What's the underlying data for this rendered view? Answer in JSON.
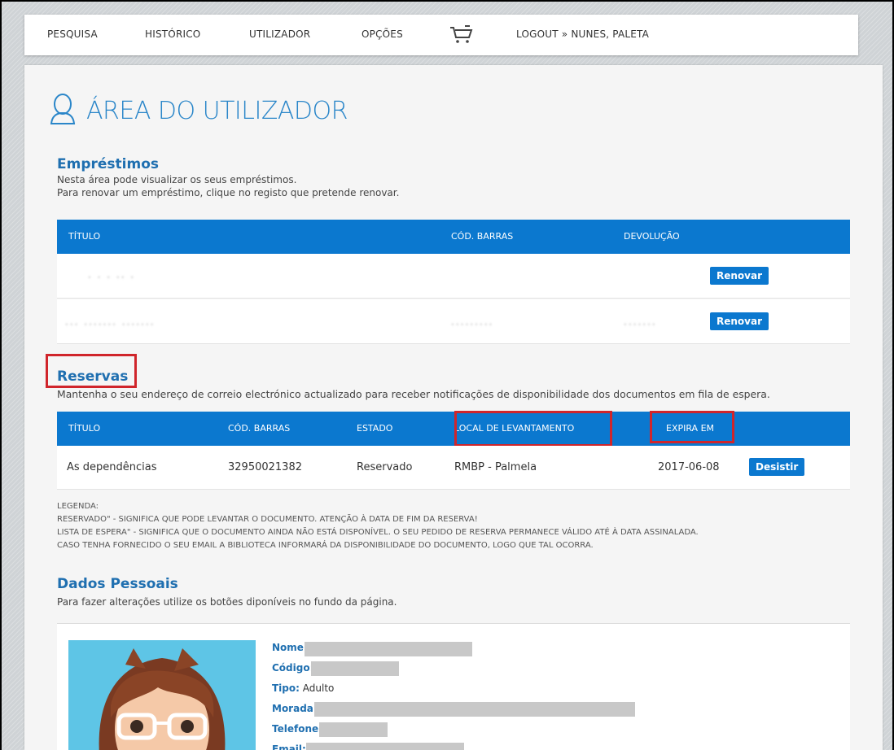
{
  "nav": {
    "items": [
      "PESQUISA",
      "HISTÓRICO",
      "UTILIZADOR",
      "OPÇÕES"
    ],
    "cart_icon": "shopping-cart-icon",
    "logout": "LOGOUT » NUNES, PALETA"
  },
  "page": {
    "title": "ÁREA DO UTILIZADOR",
    "title_icon": "user-icon"
  },
  "emprestimos": {
    "title": "Empréstimos",
    "desc1": "Nesta área pode visualizar os seus empréstimos.",
    "desc2": "Para renovar um empréstimo, clique no registo que pretende renovar.",
    "headers": [
      "TÍTULO",
      "CÓD. BARRAS",
      "DEVOLUÇÃO"
    ],
    "rows": [
      {
        "title": "· · ·  ·· ·",
        "barcode": "",
        "due": "",
        "button": "Renovar"
      },
      {
        "title": "··· ······· ·······",
        "barcode": "·········",
        "due": "·······",
        "button": "Renovar"
      }
    ]
  },
  "reservas": {
    "title": "Reservas",
    "desc": "Mantenha o seu endereço de correio electrónico actualizado para receber notificações de disponibilidade dos documentos em fila de espera.",
    "headers": [
      "TÍTULO",
      "CÓD. BARRAS",
      "ESTADO",
      "LOCAL DE LEVANTAMENTO",
      "EXPIRA EM"
    ],
    "rows": [
      {
        "title": "As dependências",
        "barcode": "32950021382",
        "status": "Reservado",
        "location": "RMBP - Palmela",
        "expires": "2017-06-08",
        "button": "Desistir"
      }
    ]
  },
  "legend": {
    "label": "LEGENDA:",
    "line1": "RESERVADO\" - SIGNIFICA QUE PODE LEVANTAR O DOCUMENTO. ATENÇÃO À DATA DE FIM DA RESERVA!",
    "line2": "LISTA DE ESPERA\" - SIGNIFICA QUE O DOCUMENTO AINDA NÃO ESTÁ DISPONÍVEL. O SEU PEDIDO DE RESERVA PERMANECE VÁLIDO ATÉ À DATA ASSINALADA.",
    "line3": "CASO TENHA FORNECIDO O SEU EMAIL A BIBLIOTECA INFORMARÁ DA DISPONIBILIDADE DO DOCUMENTO, LOGO QUE TAL OCORRA."
  },
  "dados": {
    "title": "Dados Pessoais",
    "desc": "Para fazer alterações utilize os botões diponíveis no fundo da página.",
    "fields": [
      {
        "label": "Nome:",
        "value": ""
      },
      {
        "label": "Código:",
        "value": ""
      },
      {
        "label": "Tipo:",
        "value": "Adulto"
      },
      {
        "label": "Morada:",
        "value": ""
      },
      {
        "label": "Telefone:",
        "value": ""
      },
      {
        "label": "Email:",
        "value": ""
      }
    ]
  },
  "colors": {
    "accent": "#0b78cf",
    "title_blue": "#2a86c9",
    "highlight": "#d0252b"
  }
}
